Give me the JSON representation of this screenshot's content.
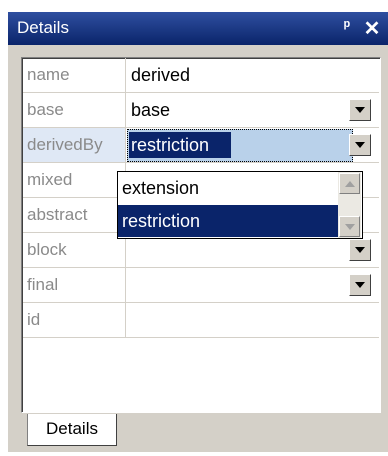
{
  "window": {
    "title": "Details",
    "pin_icon": "pin-icon",
    "close_icon": "close-icon"
  },
  "properties": [
    {
      "key": "name",
      "value": "derived"
    },
    {
      "key": "base",
      "value": "base",
      "dropdown": true
    },
    {
      "key": "derivedBy",
      "value": "restriction",
      "dropdown": true,
      "selected": true
    },
    {
      "key": "mixed",
      "value": ""
    },
    {
      "key": "abstract",
      "value": ""
    },
    {
      "key": "block",
      "value": "",
      "dropdown": true
    },
    {
      "key": "final",
      "value": "",
      "dropdown": true
    },
    {
      "key": "id",
      "value": ""
    }
  ],
  "dropdown": {
    "options": [
      "extension",
      "restriction"
    ],
    "selected": "restriction"
  },
  "tab": {
    "label": "Details"
  },
  "colors": {
    "titlebar": "#0a246a",
    "selection": "#0a246a",
    "chrome": "#d4d0c8"
  }
}
